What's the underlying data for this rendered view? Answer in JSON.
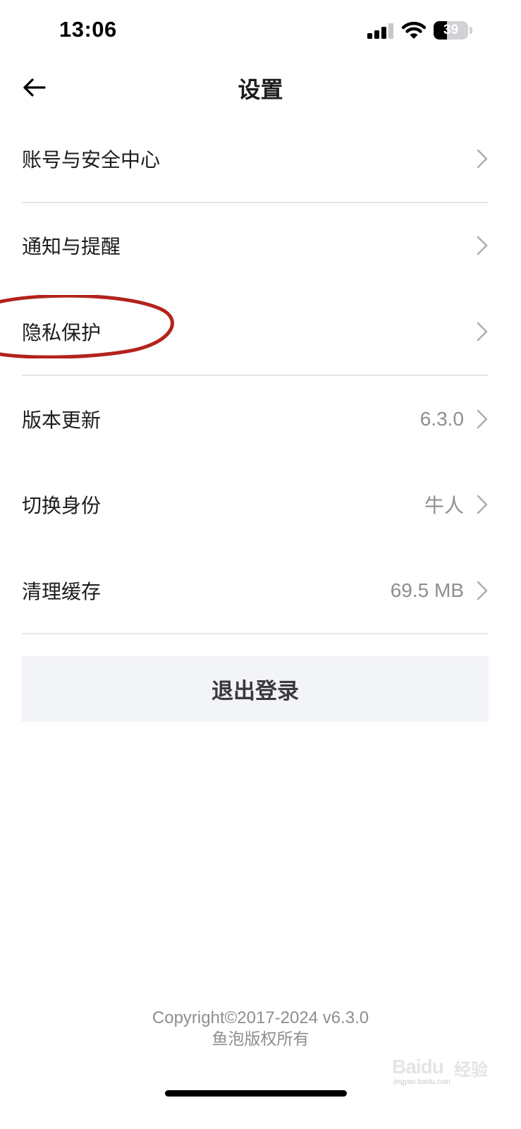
{
  "status_bar": {
    "time": "13:06",
    "battery_level": "39",
    "battery_fraction": 0.39,
    "icons": [
      "signal-icon",
      "wifi-icon",
      "battery-icon"
    ]
  },
  "nav": {
    "title": "设置",
    "back_icon": "arrow-left-icon"
  },
  "settings": {
    "items": [
      {
        "label": "账号与安全中心",
        "value": ""
      },
      {
        "label": "通知与提醒",
        "value": ""
      },
      {
        "label": "隐私保护",
        "value": ""
      },
      {
        "label": "版本更新",
        "value": "6.3.0"
      },
      {
        "label": "切换身份",
        "value": "牛人"
      },
      {
        "label": "清理缓存",
        "value": "69.5 MB"
      }
    ],
    "chevron_icon": "chevron-right-icon"
  },
  "annotation": {
    "color": "#b3231b"
  },
  "logout": {
    "label": "退出登录"
  },
  "footer": {
    "copyright": "Copyright©2017-2024 v6.3.0",
    "owner": "鱼泡版权所有"
  },
  "watermark": {
    "brand": "Baidu",
    "suffix": "经验",
    "domain": "jingyan.baidu.com"
  },
  "colors": {
    "text_primary": "#1c1c1e",
    "text_secondary": "#8e8e93",
    "divider": "#e5e5ea",
    "button_bg": "#f3f4f8"
  }
}
